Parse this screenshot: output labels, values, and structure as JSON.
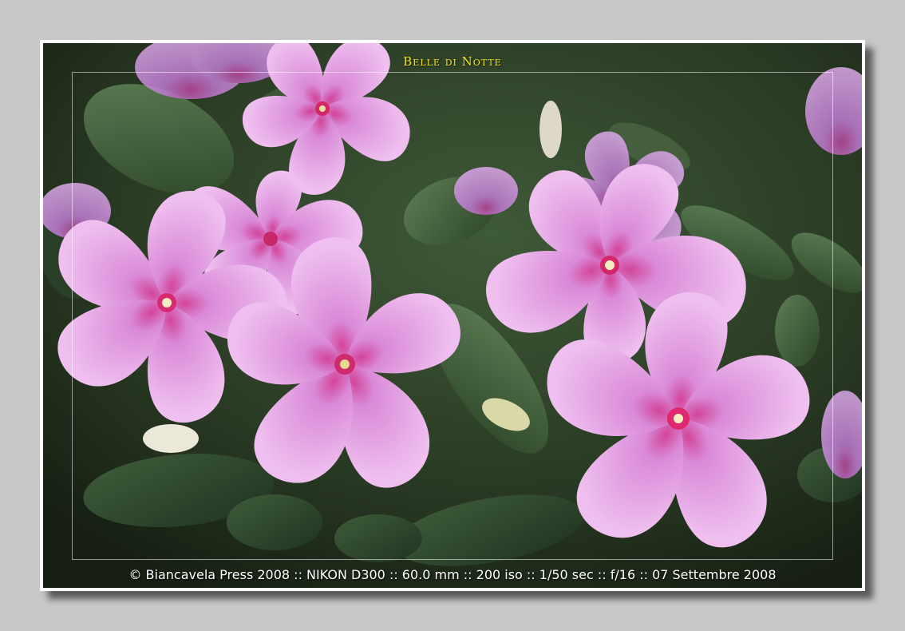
{
  "photo": {
    "title": "Belle di Notte",
    "caption": "© Biancavela Press 2008 :: NIKON D300 :: 60.0 mm :: 200 iso :: 1/50 sec :: f/16 :: 07 Settembre 2008"
  },
  "colors": {
    "background": "#c8c8c8",
    "frame": "#ffffff",
    "title": "#f2e41c",
    "caption": "#ffffff",
    "leaf_dark": "#2f4a2c",
    "leaf_mid": "#4f6f48",
    "petal_light": "#e6a4e4",
    "petal_mid": "#d584d6",
    "eye": "#d8286a"
  }
}
